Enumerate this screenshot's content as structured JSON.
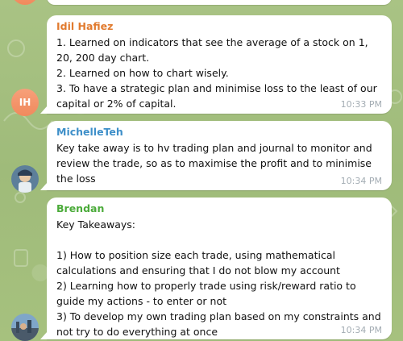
{
  "messages": [
    {
      "sender": "Idil Hafiez",
      "sender_color": "#e17b2f",
      "avatar_initials": "IH",
      "text": "1. Learned on indicators that see the average of a stock on 1, 20, 200 day chart.\n2. Learned on how to chart wisely.\n3. To have a strategic plan and minimise loss to the least of our capital or 2% of capital.",
      "time": "10:33 PM"
    },
    {
      "sender": "MichelleTeh",
      "sender_color": "#3e8fc9",
      "text": "Key take away is to hv trading plan and journal to monitor and review the trade, so as to maximise the profit and to minimise the loss",
      "time": "10:34 PM"
    },
    {
      "sender": "Brendan",
      "sender_color": "#4bab3a",
      "text": "Key Takeaways:\n\n1) How to position size each trade, using mathematical calculations and ensuring that I do not blow my account\n2) Learning how to properly trade using risk/reward ratio to guide my actions - to enter or not\n3) To develop my own trading plan based on my constraints and not try to do everything at once",
      "time": "10:34 PM"
    }
  ]
}
